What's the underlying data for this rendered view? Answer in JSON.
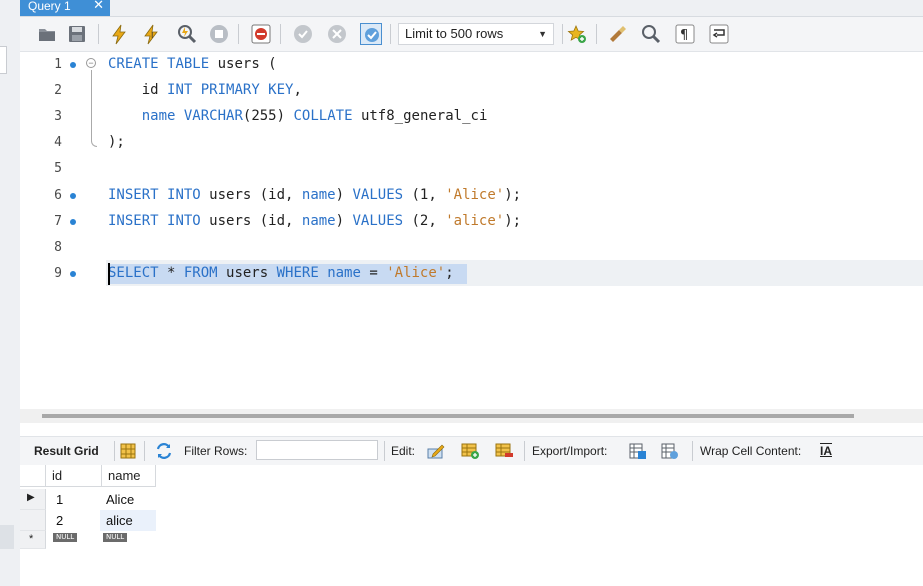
{
  "tab": {
    "title": "Query 1",
    "close": "✕"
  },
  "toolbar": {
    "limit_select": "Limit to 500 rows",
    "icons": [
      "open-file-icon",
      "save-icon",
      "execute-icon",
      "execute-current-icon",
      "explain-icon",
      "stop-icon",
      "error-toggle-icon",
      "commit-icon",
      "rollback-icon",
      "autocommit-icon",
      "add-snippet-icon",
      "beautify-icon",
      "find-icon",
      "invisible-chars-icon",
      "wrap-icon"
    ]
  },
  "editor": {
    "lines": [
      {
        "n": "1",
        "marker": true
      },
      {
        "n": "2",
        "marker": false
      },
      {
        "n": "3",
        "marker": false
      },
      {
        "n": "4",
        "marker": false
      },
      {
        "n": "5",
        "marker": false
      },
      {
        "n": "6",
        "marker": true
      },
      {
        "n": "7",
        "marker": true
      },
      {
        "n": "8",
        "marker": false
      },
      {
        "n": "9",
        "marker": true
      }
    ],
    "tokens": {
      "l1_create": "CREATE",
      "l1_table": "TABLE",
      "l1_rest": " users (",
      "l2_id": "id",
      "l2_type": "INT",
      "l2_pk": "PRIMARY KEY",
      "l2_comma": ",",
      "l3_name": "name",
      "l3_type": "VARCHAR",
      "l3_open": "(",
      "l3_len": "255",
      "l3_close": ")",
      "l3_collate": "COLLATE",
      "l3_coll": " utf8_general_ci",
      "l4": ");",
      "insert": "INSERT",
      "into": "INTO",
      "users_cols": " users (id, ",
      "name_kw": "name",
      "cols_close": ")",
      "values": "VALUES",
      "v1_open": " (1, ",
      "v1_str": "'Alice'",
      "v2_open": " (2, ",
      "v2_str": "'alice'",
      "tail": ");",
      "select": "SELECT",
      "star": " * ",
      "from": "FROM",
      "users": " users ",
      "where": "WHERE",
      "eq": " = ",
      "sel_str": "'Alice'",
      "semi": ";"
    }
  },
  "result_toolbar": {
    "result_grid": "Result Grid",
    "filter_rows": "Filter Rows:",
    "edit": "Edit:",
    "export_import": "Export/Import:",
    "wrap_cell": "Wrap Cell Content:",
    "wrap_icon_text": "IA"
  },
  "grid": {
    "columns": [
      "id",
      "name"
    ],
    "rows": [
      {
        "id": "1",
        "name": "Alice"
      },
      {
        "id": "2",
        "name": "alice"
      }
    ],
    "null_label": "NULL",
    "new_row_marker": "*",
    "current_row_marker": "▶"
  }
}
